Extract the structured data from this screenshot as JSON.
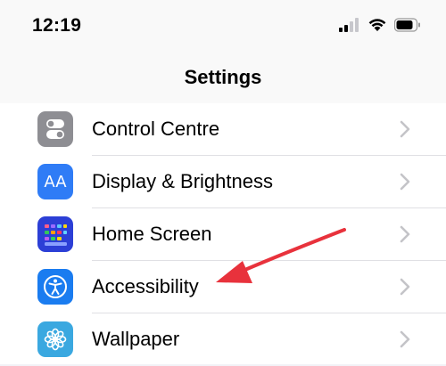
{
  "status": {
    "time": "12:19"
  },
  "nav": {
    "title": "Settings"
  },
  "rows": [
    {
      "label": "Control Centre",
      "icon": "control-centre-icon",
      "icon_color": "#8e8e93"
    },
    {
      "label": "Display & Brightness",
      "icon": "display-brightness-icon",
      "icon_color": "#2f7cf6",
      "icon_text": "AA"
    },
    {
      "label": "Home Screen",
      "icon": "home-screen-icon",
      "icon_color": "#2c3fd6"
    },
    {
      "label": "Accessibility",
      "icon": "accessibility-icon",
      "icon_color": "#1a7cf0"
    },
    {
      "label": "Wallpaper",
      "icon": "wallpaper-icon",
      "icon_color": "#3aa8e0"
    }
  ],
  "annotation": {
    "color": "#e8323c"
  }
}
